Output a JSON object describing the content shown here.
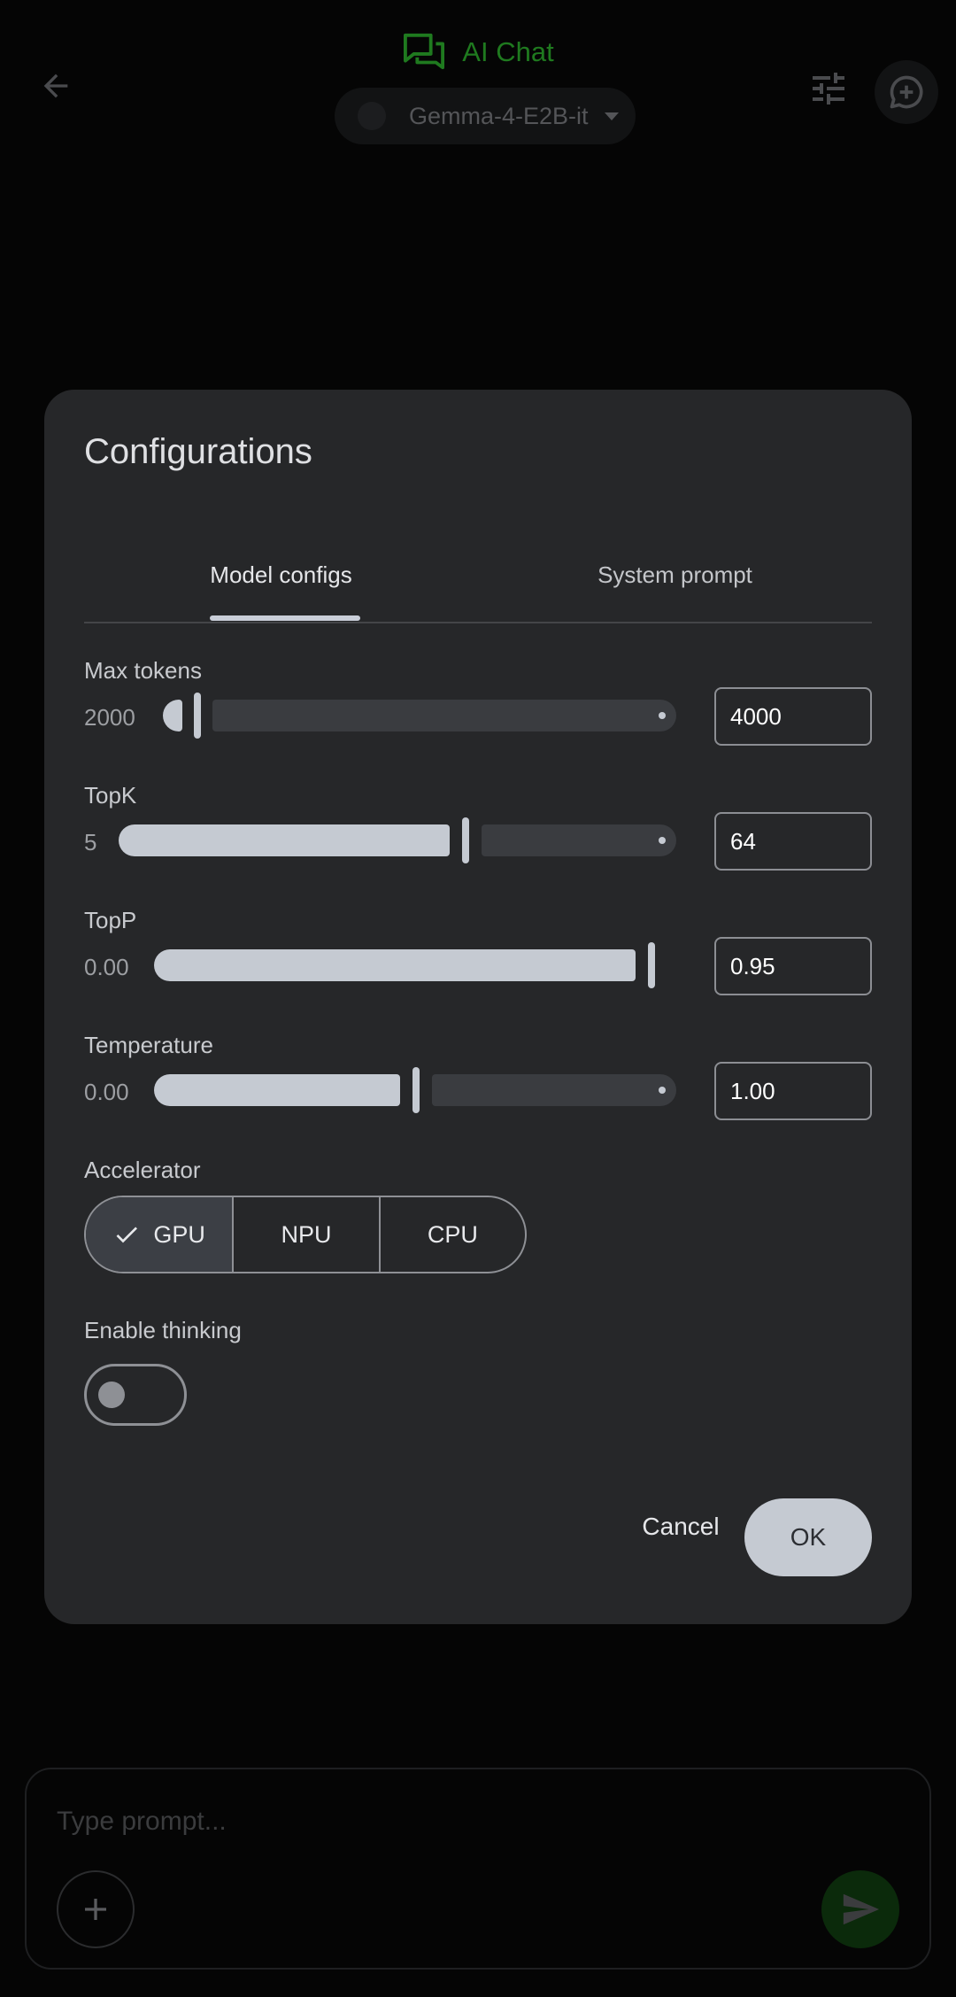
{
  "app": {
    "title": "AI Chat",
    "model_selector": {
      "selected": "Gemma-4-E2B-it"
    },
    "composer": {
      "placeholder": "Type prompt..."
    }
  },
  "dialog": {
    "title": "Configurations",
    "tabs": [
      {
        "label": "Model configs",
        "selected": true
      },
      {
        "label": "System prompt",
        "selected": false
      }
    ],
    "params": {
      "max_tokens": {
        "label": "Max tokens",
        "min": "2000",
        "value": "4000",
        "fraction": 0.0
      },
      "topk": {
        "label": "TopK",
        "min": "5",
        "value": "64",
        "fraction": 0.69
      },
      "topp": {
        "label": "TopP",
        "min": "0.00",
        "value": "0.95",
        "fraction": 0.95
      },
      "temperature": {
        "label": "Temperature",
        "min": "0.00",
        "value": "1.00",
        "fraction": 0.5
      }
    },
    "accelerator": {
      "label": "Accelerator",
      "options": [
        "GPU",
        "NPU",
        "CPU"
      ],
      "selected": "GPU"
    },
    "thinking": {
      "label": "Enable thinking",
      "enabled": false
    },
    "buttons": {
      "cancel": "Cancel",
      "ok": "OK"
    }
  },
  "colors": {
    "accent_green": "#1f7a1f",
    "dialog_bg": "#262729",
    "slider_active": "#c5cad2",
    "slider_inactive": "#3a3c40"
  }
}
